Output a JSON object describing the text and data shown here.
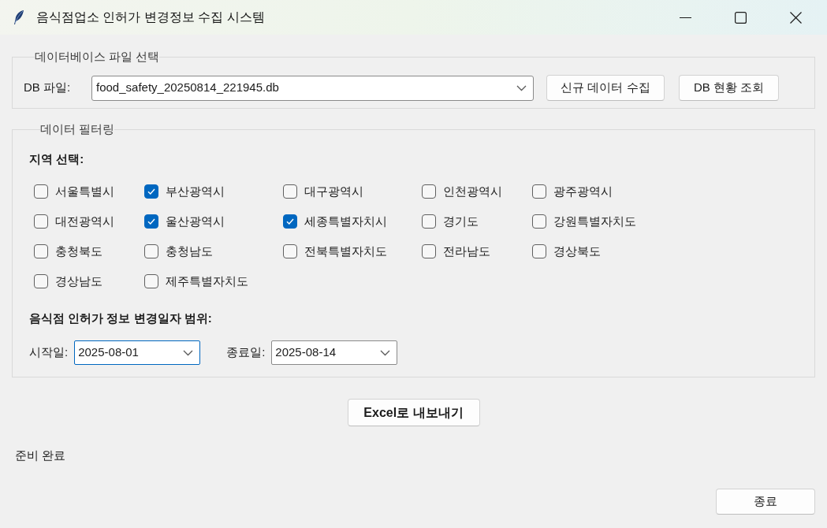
{
  "window": {
    "title": "음식점업소 인허가 변경정보 수집 시스템"
  },
  "database_group": {
    "title": "데이터베이스 파일 선택",
    "file_label": "DB 파일:",
    "file_value": "food_safety_20250814_221945.db",
    "buttons": [
      "신규 데이터 수집",
      "DB 현황 조회"
    ]
  },
  "filter_group": {
    "title": "데이터 필터링",
    "region_heading": "지역 선택:",
    "regions": [
      {
        "label": "서울특별시",
        "checked": false
      },
      {
        "label": "부산광역시",
        "checked": true
      },
      {
        "label": "대구광역시",
        "checked": false
      },
      {
        "label": "인천광역시",
        "checked": false
      },
      {
        "label": "광주광역시",
        "checked": false
      },
      {
        "label": "대전광역시",
        "checked": false
      },
      {
        "label": "울산광역시",
        "checked": true
      },
      {
        "label": "세종특별자치시",
        "checked": true
      },
      {
        "label": "경기도",
        "checked": false
      },
      {
        "label": "강원특별자치도",
        "checked": false
      },
      {
        "label": "충청북도",
        "checked": false
      },
      {
        "label": "충청남도",
        "checked": false
      },
      {
        "label": "전북특별자치도",
        "checked": false
      },
      {
        "label": "전라남도",
        "checked": false
      },
      {
        "label": "경상북도",
        "checked": false
      },
      {
        "label": "경상남도",
        "checked": false
      },
      {
        "label": "제주특별자치도",
        "checked": false
      }
    ],
    "date_heading": "음식점 인허가 정보 변경일자 범위:",
    "date_fields": [
      {
        "label": "시작일:",
        "value": "2025-08-01",
        "focused": true
      },
      {
        "label": "종료일:",
        "value": "2025-08-14",
        "focused": false
      }
    ]
  },
  "export_button": "Excel로 내보내기",
  "status_bar": {
    "text": "준비 완료"
  },
  "exit_button": "종료"
}
